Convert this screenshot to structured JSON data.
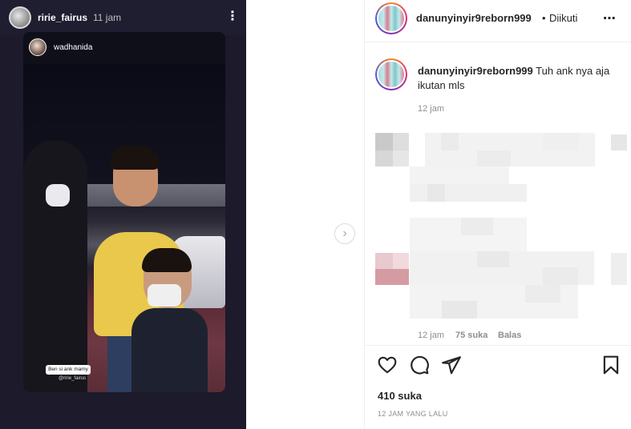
{
  "story": {
    "username": "ririe_fairus",
    "time": "11 jam",
    "inner_username": "wadhanida",
    "sticker_text": "Ben si ank mamy 😊",
    "sticker_tag": "@ririe_fairus"
  },
  "header": {
    "username": "danunyinyir9reborn999",
    "separator": "•",
    "follow_label": "Diikuti",
    "more_label": "⋯"
  },
  "caption": {
    "username": "danunyinyir9reborn999",
    "text": " Tuh ank nya aja ikutan mls",
    "time": "12 jam"
  },
  "comment": {
    "time": "12 jam",
    "likes": "75 suka",
    "reply_label": "Balas"
  },
  "footer": {
    "likes_total": "410 suka",
    "post_time": "12 JAM YANG LALU"
  },
  "icons": {
    "like": "heart-icon",
    "comment": "comment-icon",
    "share": "send-icon",
    "save": "bookmark-icon",
    "next": "chevron-right-icon"
  },
  "colors": {
    "text_primary": "#262626",
    "text_secondary": "#8e8e8e",
    "story_ring_gradient": [
      "#f58529",
      "#dd2a7b",
      "#8134af",
      "#515bd4"
    ]
  }
}
